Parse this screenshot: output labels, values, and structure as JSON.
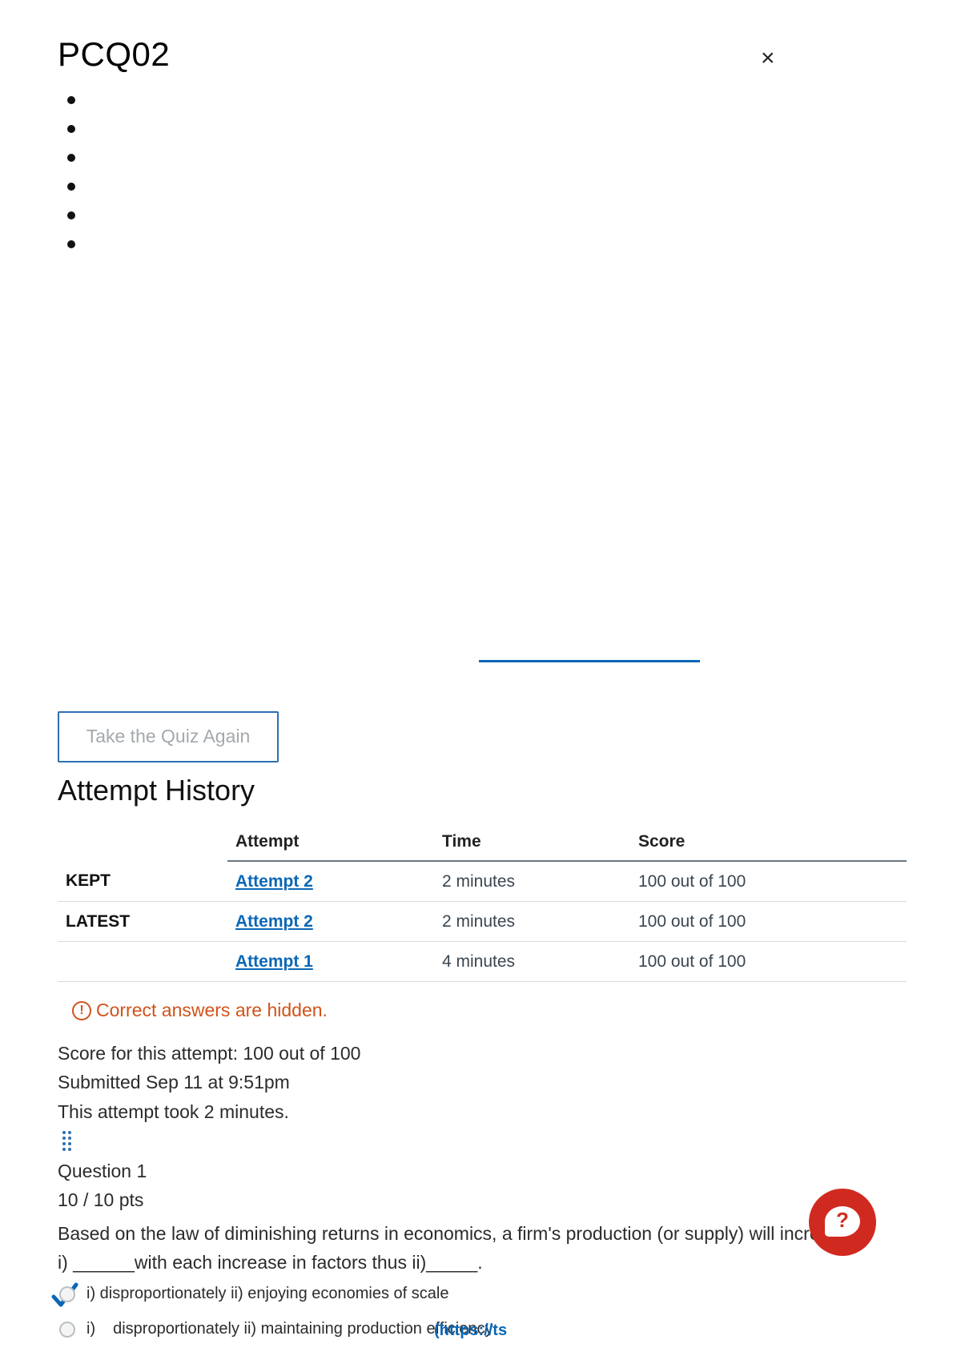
{
  "header": {
    "title": "PCQ02",
    "close_glyph": "×"
  },
  "retake_button": "Take the Quiz Again",
  "attempt_history": {
    "heading": "Attempt History",
    "columns": [
      "",
      "Attempt",
      "Time",
      "Score"
    ],
    "rows": [
      {
        "label": "KEPT",
        "attempt": "Attempt 2",
        "time": "2 minutes",
        "score": "100 out of 100"
      },
      {
        "label": "LATEST",
        "attempt": "Attempt 2",
        "time": "2 minutes",
        "score": "100 out of 100"
      },
      {
        "label": "",
        "attempt": "Attempt 1",
        "time": "4 minutes",
        "score": "100 out of 100"
      }
    ]
  },
  "notice": {
    "icon": "!",
    "text": "Correct answers are hidden."
  },
  "attempt_info": {
    "score": "Score for this attempt: 100 out of 100",
    "submitted": "Submitted Sep 11 at 9:51pm",
    "duration": "This attempt took 2 minutes."
  },
  "question": {
    "title": "Question 1",
    "points": "10 / 10 pts",
    "text_line1": "Based on the law of diminishing returns in economics, a firm's production (or supply) will increase",
    "text_line2": "i) ______with each increase in factors thus ii)_____.",
    "answers": [
      {
        "text": "i) disproportionately ii) enjoying economies of scale",
        "selected": true
      },
      {
        "text_prefix": "i)",
        "text": "disproportionately ii) maintaining production efficiency",
        "selected": false
      }
    ],
    "inline_link": "(https://ts"
  },
  "colors": {
    "accent": "#0b67b6",
    "warning": "#d0531a",
    "help": "#d02a20"
  }
}
